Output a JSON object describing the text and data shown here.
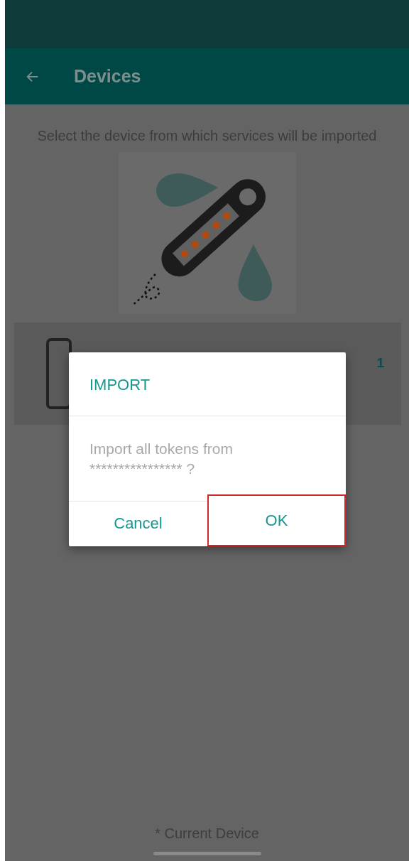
{
  "app_bar": {
    "title": "Devices"
  },
  "instruction": "Select the device from which services will be imported",
  "devices": [
    {
      "count": "1"
    }
  ],
  "footer": "* Current Device",
  "dialog": {
    "title": "IMPORT",
    "message": "Import all tokens from\n****************  ?",
    "buttons": [
      {
        "label": "Cancel",
        "highlighted": false
      },
      {
        "label": "OK",
        "highlighted": true
      }
    ]
  }
}
